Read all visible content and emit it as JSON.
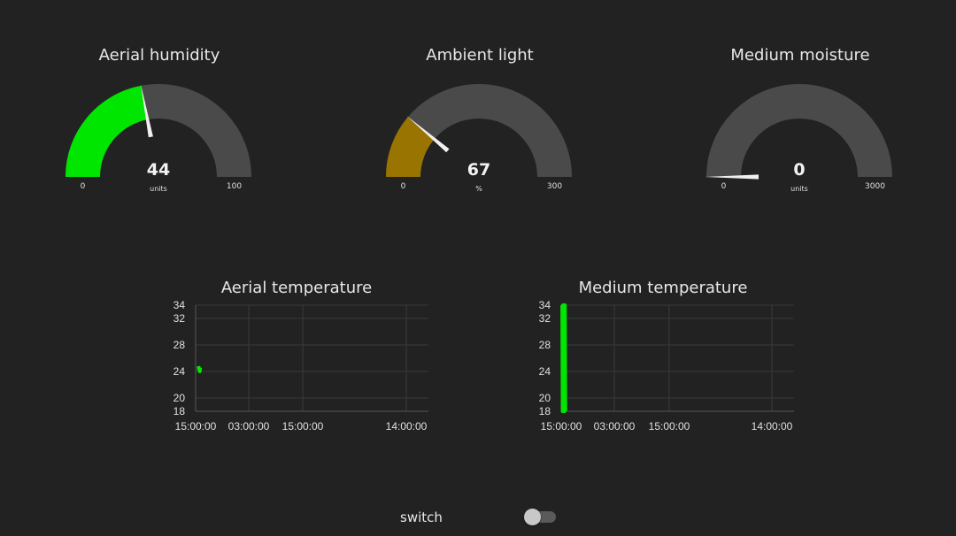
{
  "colors": {
    "background": "#222222",
    "gauge_track": "#4a4a4a",
    "needle": "#f0f0f0",
    "humidity_fill": "#00e600",
    "light_fill": "#9a7400",
    "moisture_fill": "#00e600",
    "line_series": "#00e600",
    "grid": "#3a3a3a",
    "axis_text": "#e0e0e0"
  },
  "gauges": [
    {
      "title": "Aerial humidity",
      "value": 44,
      "display": "44",
      "units": "units",
      "min": 0,
      "max": 100,
      "min_label": "0",
      "max_label": "100",
      "fill_color": "#00e600"
    },
    {
      "title": "Ambient light",
      "value": 67,
      "display": "67",
      "units": "%",
      "min": 0,
      "max": 300,
      "min_label": "0",
      "max_label": "300",
      "fill_color": "#9a7400"
    },
    {
      "title": "Medium moisture",
      "value": 0,
      "display": "0",
      "units": "units",
      "min": 0,
      "max": 3000,
      "min_label": "0",
      "max_label": "3000",
      "fill_color": "#00e600"
    }
  ],
  "chart_data": [
    {
      "type": "line",
      "title": "Aerial temperature",
      "x_ticks": [
        "15:00:00",
        "03:00:00",
        "15:00:00",
        "14:00:00"
      ],
      "y_ticks": [
        18,
        20,
        24,
        28,
        32,
        34
      ],
      "ylim": [
        18,
        34
      ],
      "grid": true,
      "series": [
        {
          "color": "#00e600",
          "points": [
            [
              0.012,
              24.8
            ],
            [
              0.014,
              24.4
            ],
            [
              0.018,
              24.0
            ],
            [
              0.02,
              24.6
            ]
          ]
        }
      ]
    },
    {
      "type": "line",
      "title": "Medium temperature",
      "x_ticks": [
        "15:00:00",
        "03:00:00",
        "15:00:00",
        "14:00:00"
      ],
      "y_ticks": [
        18,
        20,
        24,
        28,
        32,
        34
      ],
      "ylim": [
        18,
        34
      ],
      "grid": true,
      "series": [
        {
          "color": "#00e600",
          "points": [
            [
              0.004,
              34
            ],
            [
              0.006,
              18
            ],
            [
              0.008,
              34
            ],
            [
              0.01,
              18
            ],
            [
              0.012,
              25
            ],
            [
              0.014,
              18
            ],
            [
              0.016,
              34
            ],
            [
              0.018,
              18
            ]
          ]
        }
      ]
    }
  ],
  "switch": {
    "label": "switch",
    "on": false
  }
}
